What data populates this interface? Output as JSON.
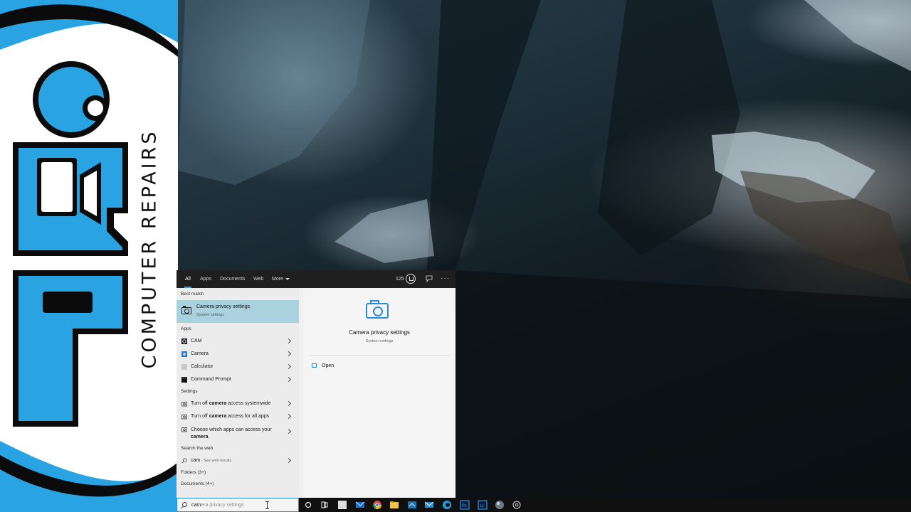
{
  "logo": {
    "brand_text": "COMPUTER REPAIRS",
    "colors": {
      "blue": "#2aa3e3",
      "black": "#0b0b0b",
      "white": "#ffffff"
    }
  },
  "search_panel": {
    "tabs": [
      {
        "label": "All",
        "active": true
      },
      {
        "label": "Apps",
        "active": false
      },
      {
        "label": "Documents",
        "active": false
      },
      {
        "label": "Web",
        "active": false
      },
      {
        "label": "More",
        "active": false
      }
    ],
    "points": "125",
    "more_options_label": "···",
    "best_match": {
      "section_label": "Best match",
      "title": "Camera privacy settings",
      "subtitle": "System settings"
    },
    "apps": {
      "section_label": "Apps",
      "items": [
        {
          "label": "CAM",
          "icon": "cam-app-icon"
        },
        {
          "label": "Camera",
          "icon": "camera-app-icon"
        },
        {
          "label": "Calculator",
          "icon": "calculator-icon"
        },
        {
          "label": "Command Prompt",
          "icon": "command-prompt-icon"
        }
      ]
    },
    "settings": {
      "section_label": "Settings",
      "items": [
        {
          "pre": "Turn off ",
          "bold": "camera",
          "post": " access systemwide"
        },
        {
          "pre": "Turn off ",
          "bold": "camera",
          "post": " access for all apps"
        },
        {
          "pre": "Choose which apps can access your",
          "line2": "camera"
        }
      ]
    },
    "web": {
      "section_label": "Search the web",
      "query": "cam",
      "suffix": " - See web results"
    },
    "folders_label": "Folders (3+)",
    "documents_label": "Documents (4+)",
    "preview": {
      "title": "Camera privacy settings",
      "subtitle": "System settings",
      "open_label": "Open"
    }
  },
  "taskbar": {
    "search_typed": "cam",
    "search_ghost": "era privacy settings",
    "accent": "#2a8bd6",
    "icons": [
      "cortana-icon",
      "task-view-icon",
      "file-icon",
      "mail-icon",
      "chrome-icon",
      "file-explorer-icon",
      "steam-icon",
      "mail-icon-2",
      "edge-icon",
      "photoshop-icon",
      "lightroom-icon",
      "app-sphere-icon",
      "settings-app-icon"
    ]
  }
}
